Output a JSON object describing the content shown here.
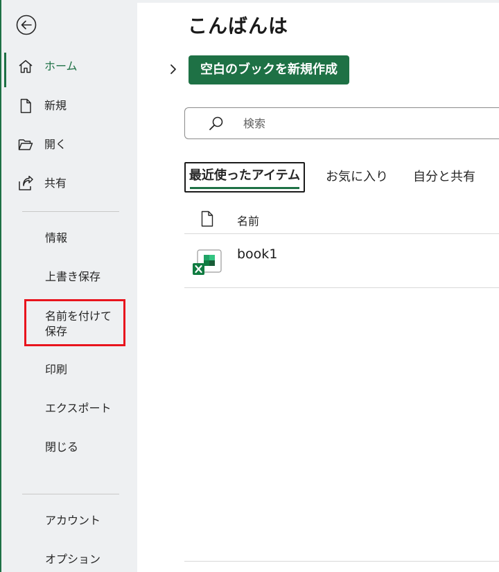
{
  "sidebar": {
    "nav": [
      {
        "id": "home",
        "label": "ホーム",
        "icon": "home-icon",
        "active": true
      },
      {
        "id": "new",
        "label": "新規",
        "icon": "new-document-icon"
      },
      {
        "id": "open",
        "label": "開く",
        "icon": "open-folder-icon"
      },
      {
        "id": "share",
        "label": "共有",
        "icon": "share-icon"
      }
    ],
    "menu": {
      "info": "情報",
      "overwrite_save": "上書き保存",
      "save_as_line1": "名前を付けて",
      "save_as_line2": "保存",
      "print": "印刷",
      "export": "エクスポート",
      "close": "閉じる",
      "account": "アカウント",
      "options": "オプション"
    }
  },
  "main": {
    "greeting": "こんばんは",
    "new_blank_book": "空白のブックを新規作成",
    "search": {
      "placeholder": "検索",
      "value": ""
    },
    "tabs": [
      {
        "label": "最近使ったアイテム",
        "active": true
      },
      {
        "label": "お気に入り"
      },
      {
        "label": "自分と共有"
      }
    ],
    "list": {
      "column_name": "名前",
      "files": [
        {
          "name": "book1",
          "icon": "excel-file-icon"
        }
      ]
    }
  },
  "colors": {
    "accent": "#1e7145",
    "sidebar_bg": "#eef0f2",
    "highlight": "#e8141d"
  }
}
